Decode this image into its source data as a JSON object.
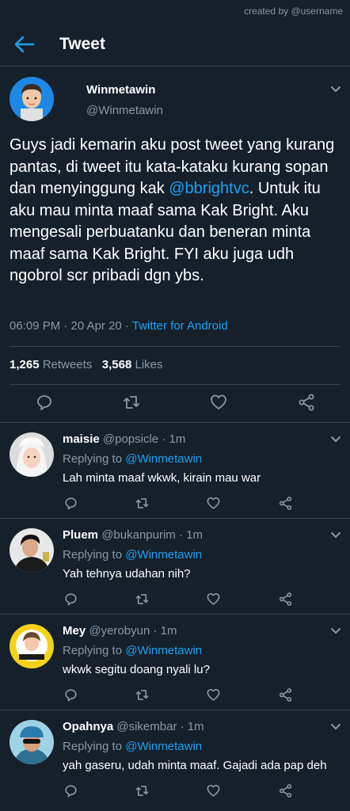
{
  "watermark": "created by @username",
  "header": {
    "title": "Tweet"
  },
  "tweet": {
    "author_name": "Winmetawin",
    "author_handle": "@Winmetawin",
    "text_1": "Guys jadi kemarin aku post tweet yang kurang pantas, di tweet itu kata-kataku kurang sopan dan menyinggung kak ",
    "mention": "@bbrightvc",
    "text_2": ". Untuk itu aku mau minta maaf sama Kak Bright. Aku mengesali perbuatanku dan beneran minta maaf sama Kak Bright. FYI aku juga udh ngobrol scr pribadi dgn ybs.",
    "time": "06:09 PM · 20 Apr 20 · ",
    "source": "Twitter for Android",
    "retweets": "1,265",
    "retweets_label": "Retweets",
    "likes": "3,568",
    "likes_label": "Likes"
  },
  "actions": {
    "reply": "reply-icon",
    "retweet": "retweet-icon",
    "like": "heart-icon",
    "share": "share-icon"
  },
  "colors": {
    "background": "#15202b",
    "accent": "#1da1f2",
    "muted": "#8899a6",
    "divider": "#38444d"
  },
  "replies": [
    {
      "name": "maisie",
      "handle": "@popsicle",
      "time": " · 1m",
      "replying_label": "Replying to ",
      "replying_to": "@Winmetawin",
      "text": "Lah minta maaf wkwk, kirain mau war"
    },
    {
      "name": "Pluem",
      "handle": "@bukanpurim",
      "time": " · 1m",
      "replying_label": "Replying to ",
      "replying_to": "@Winmetawin",
      "text": "Yah tehnya udahan nih?"
    },
    {
      "name": "Mey",
      "handle": "@yerobyun",
      "time": " · 1m",
      "replying_label": "Replying to ",
      "replying_to": "@Winmetawin",
      "text": "wkwk segitu doang nyali lu?"
    },
    {
      "name": "Opahnya",
      "handle": "@sikembar",
      "time": " · 1m",
      "replying_label": "Replying to ",
      "replying_to": "@Winmetawin",
      "text": "yah gaseru, udah minta maaf. Gajadi ada pap deh"
    }
  ]
}
